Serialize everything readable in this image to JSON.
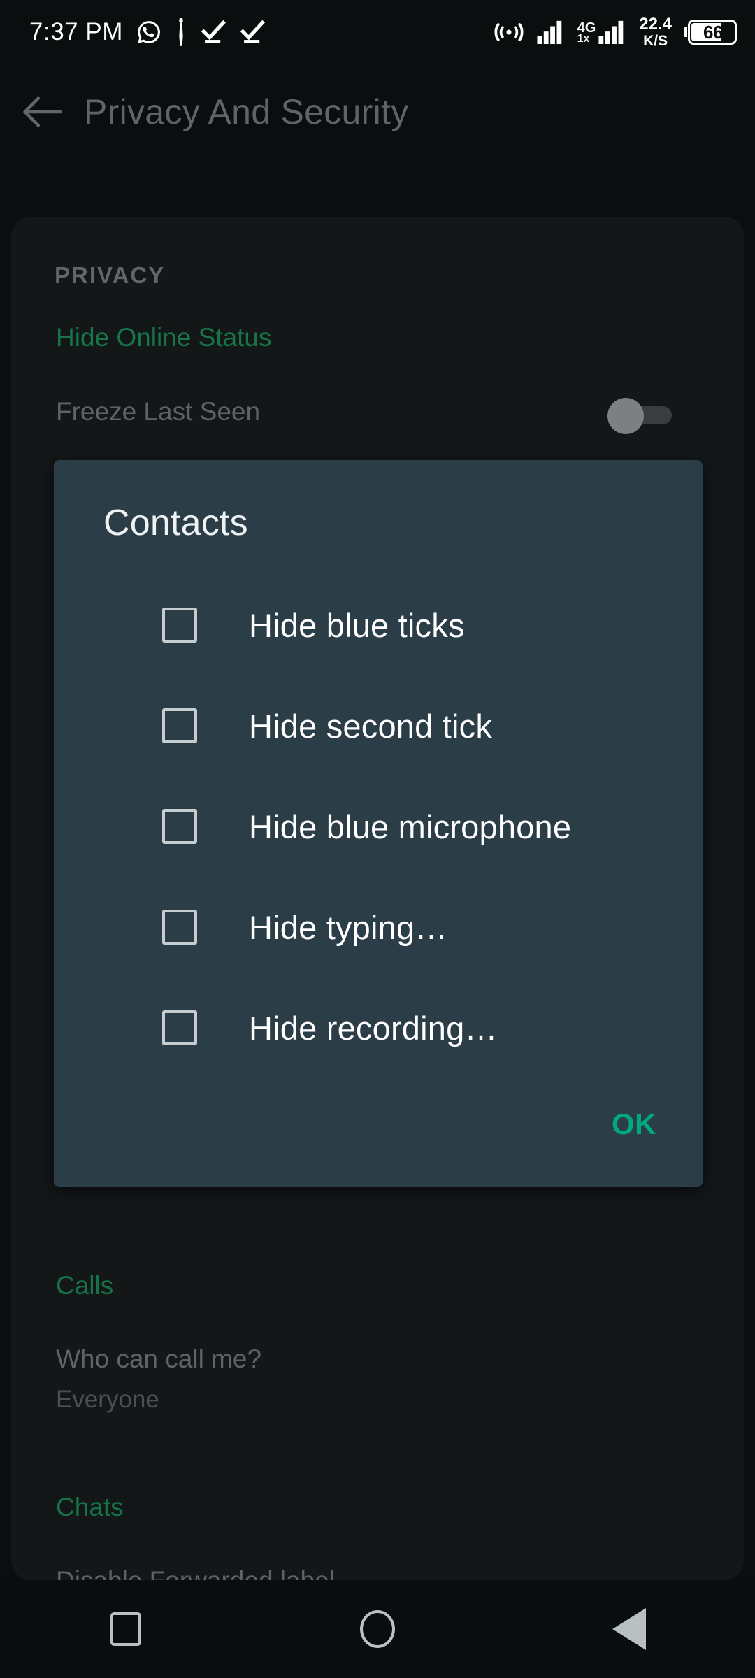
{
  "statusbar": {
    "time": "7:37 PM",
    "icons": [
      "whatsapp-icon",
      "torch-icon",
      "double-tick-icon",
      "double-tick-icon"
    ],
    "hotspot_icon": "hotspot-icon",
    "signal_icon": "signal-bars-icon",
    "network_type": "4G",
    "network_sub": "1x",
    "data_speed_value": "22.4",
    "data_speed_unit": "K/S",
    "battery_level": "66"
  },
  "toolbar": {
    "back_icon": "arrow-left-icon",
    "title": "Privacy And Security"
  },
  "settings": {
    "privacy_header": "PRIVACY",
    "hide_online_status": "Hide Online Status",
    "freeze_last_seen": "Freeze Last Seen",
    "calls_header": "Calls",
    "who_can_call_me": "Who can call me?",
    "who_can_call_me_value": "Everyone",
    "chats_header": "Chats",
    "disable_forwarded_label": "Disable Forwarded label"
  },
  "dialog": {
    "title": "Contacts",
    "items": [
      {
        "label": "Hide blue ticks",
        "checked": false
      },
      {
        "label": "Hide second tick",
        "checked": false
      },
      {
        "label": "Hide blue microphone",
        "checked": false
      },
      {
        "label": "Hide typing…",
        "checked": false
      },
      {
        "label": "Hide recording…",
        "checked": false
      }
    ],
    "ok_label": "OK"
  },
  "navbar": {
    "recents": "recents-square-icon",
    "home": "home-circle-icon",
    "back": "back-triangle-icon"
  },
  "colors": {
    "screen_bg": "#0a0e0e",
    "card_bg": "#131718",
    "dialog_bg": "#2b3e48",
    "accent_green": "#00a884",
    "section_green": "#167347",
    "muted_text": "#5d6464"
  }
}
